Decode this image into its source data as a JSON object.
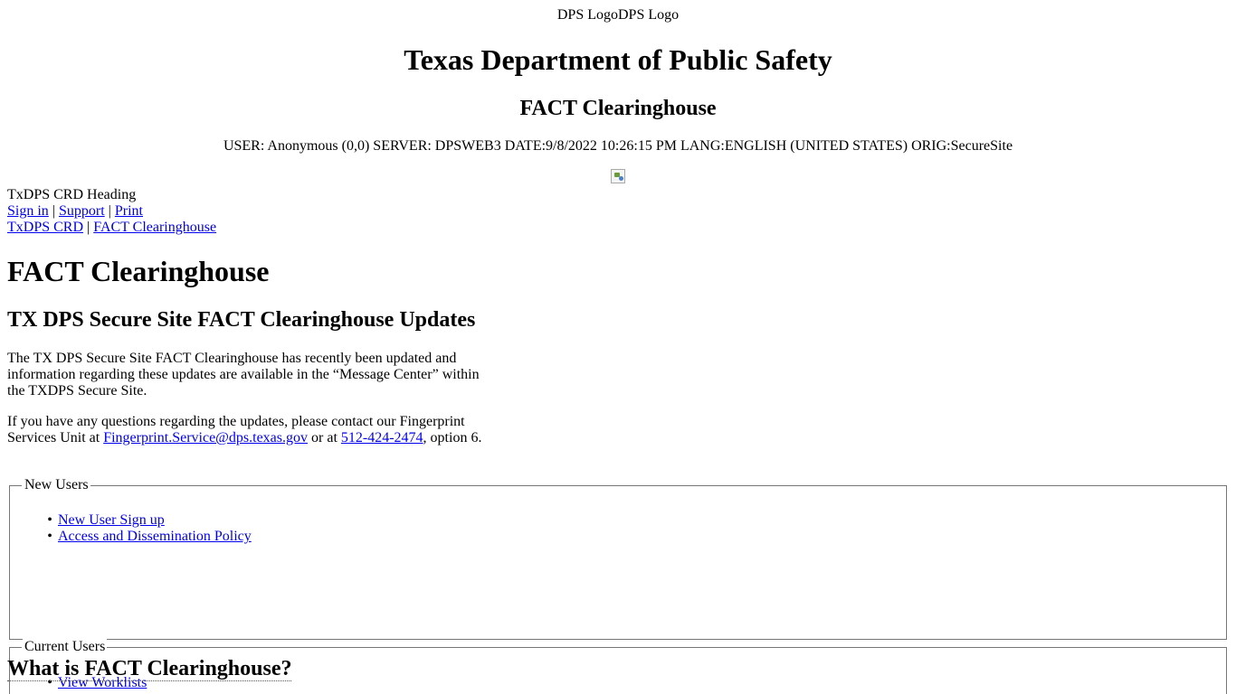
{
  "header": {
    "logo_alt_1": "DPS Logo",
    "logo_alt_2": "DPS Logo",
    "title": "Texas Department of Public Safety",
    "subtitle": "FACT Clearinghouse",
    "status_line": "USER: Anonymous (0,0) SERVER: DPSWEB3 DATE:9/8/2022 10:26:15 PM LANG:ENGLISH (UNITED STATES) ORIG:SecureSite",
    "banner_icon": "broken-image-icon"
  },
  "crd_heading_alt": "TxDPS CRD Heading",
  "nav": {
    "sign_in": "Sign in",
    "sep1": " | ",
    "support": "Support",
    "sep2": " | ",
    "print": "Print"
  },
  "breadcrumb": {
    "home": "TxDPS CRD",
    "sep": " | ",
    "current": "FACT Clearinghouse"
  },
  "main": {
    "page_title": "FACT Clearinghouse",
    "updates_title": "TX DPS Secure Site FACT Clearinghouse Updates",
    "para1": "The TX DPS Secure Site FACT Clearinghouse has recently been updated and information regarding these updates are available in the “Message Center” within the TXDPS Secure Site.",
    "para2_prefix": "If you have any questions regarding the updates, please contact our Fingerprint Services Unit at ",
    "email": "Fingerprint.Service@dps.texas.gov",
    "para2_mid": " or at ",
    "phone": "512-424-2474",
    "para2_suffix": ", option 6."
  },
  "new_users": {
    "legend": "New Users",
    "items": [
      {
        "label": "New User Sign up"
      },
      {
        "label": "Access and Dissemination Policy"
      }
    ]
  },
  "current_users": {
    "legend": "Current Users",
    "items": [
      {
        "label": "View Worklists"
      }
    ]
  },
  "what_is": {
    "title": "What is FACT Clearinghouse?"
  }
}
